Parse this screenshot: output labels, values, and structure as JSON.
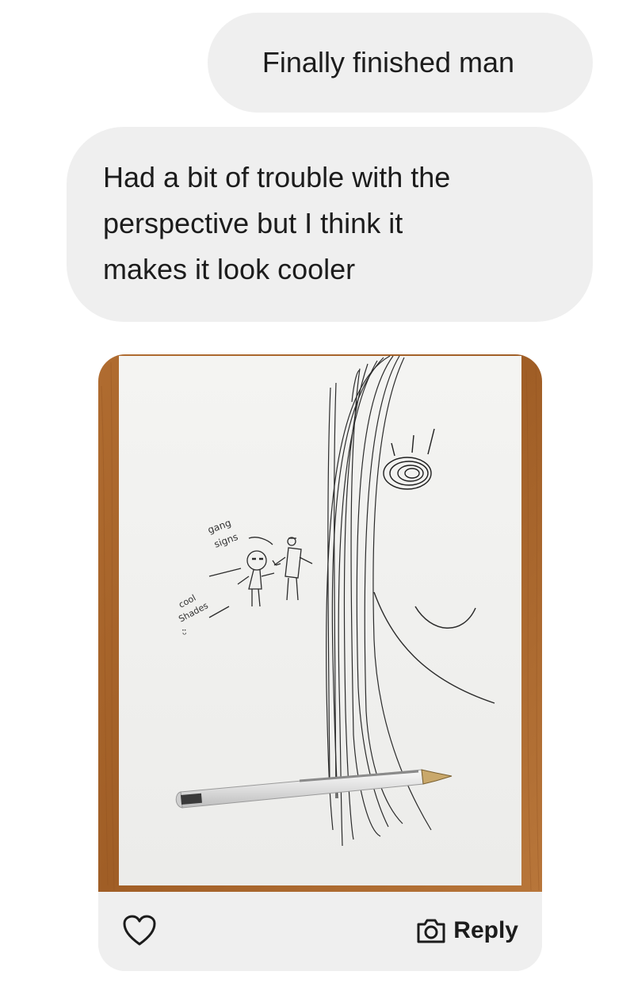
{
  "messages": [
    {
      "text": "Finally finished man"
    },
    {
      "lines": [
        "Had a bit of trouble with the",
        "perspective but I think it",
        "makes it look cooler"
      ]
    }
  ],
  "photo": {
    "annotations": {
      "gang_signs": [
        "gang",
        "signs"
      ],
      "cool_shades": [
        "cool",
        "Shades"
      ]
    }
  },
  "actions": {
    "like_icon": "heart-icon",
    "reply_icon": "camera-icon",
    "reply_label": "Reply"
  },
  "colors": {
    "bubble": "#efefef",
    "text": "#1c1c1c",
    "table_wood": "#a8642b",
    "paper": "#f3f3f1"
  }
}
